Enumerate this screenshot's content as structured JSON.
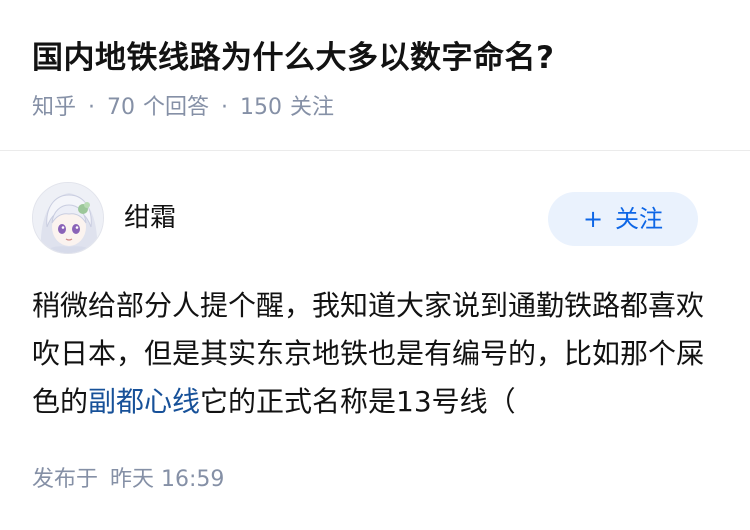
{
  "question": {
    "title": "国内地铁线路为什么大多以数字命名?",
    "source": "知乎",
    "separator": "·",
    "answer_count": "70",
    "answer_label": "个回答",
    "follower_count": "150",
    "follower_label": "关注"
  },
  "author": {
    "name": "绀霜",
    "avatar_icon": "anime-girl-avatar-icon",
    "follow_plus": "+",
    "follow_label": "关注"
  },
  "answer": {
    "text_before_link": "稍微给部分人提个醒，我知道大家说到通勤铁路都喜欢吹日本，但是其实东京地铁也是有编号的，比如那个屎色的",
    "link_text": "副都心线",
    "text_after_link": "它的正式名称是13号线（"
  },
  "publish": {
    "label": "发布于",
    "time": "昨天 16:59"
  },
  "colors": {
    "title": "#121212",
    "meta_gray": "#8590a6",
    "accent_blue": "#0d66e6",
    "follow_bg": "#eaf2fd",
    "link_blue": "#175199"
  }
}
